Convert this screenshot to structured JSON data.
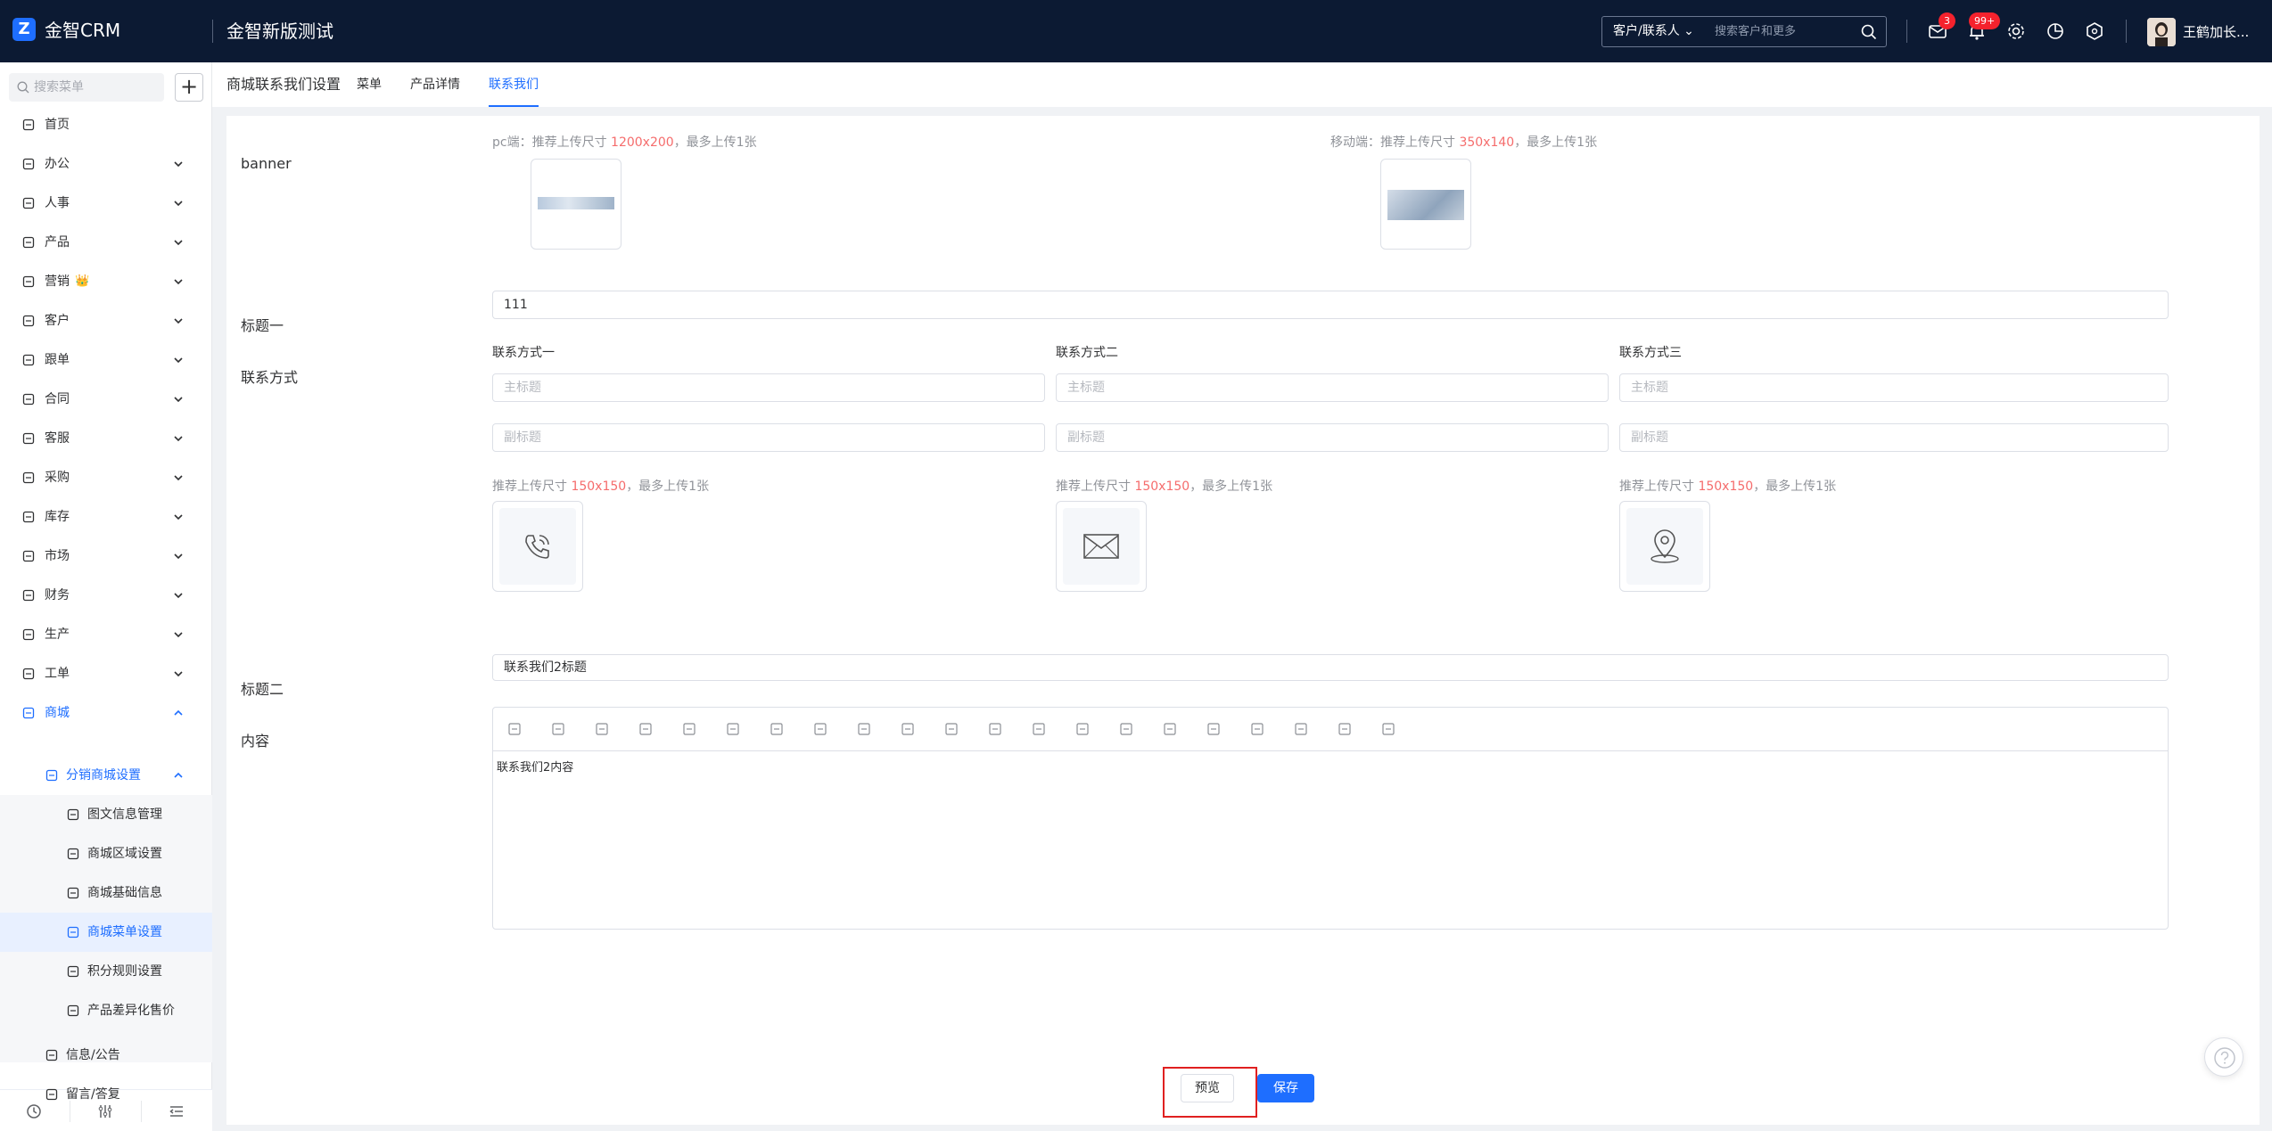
{
  "header": {
    "logo_mark": "Z",
    "app_name": "金智CRM",
    "system_title": "金智新版测试",
    "search_scope": "客户/联系人",
    "search_placeholder": "搜索客户和更多",
    "message_badge": "3",
    "notify_badge": "99+",
    "user_name": "王鹤加长..."
  },
  "sidebar": {
    "search_placeholder": "搜索菜单",
    "add_label": "+",
    "items": [
      {
        "label": "首页",
        "icon": "home-icon"
      },
      {
        "label": "办公",
        "icon": "office-icon"
      },
      {
        "label": "人事",
        "icon": "people-icon"
      },
      {
        "label": "产品",
        "icon": "product-icon"
      },
      {
        "label": "营销",
        "icon": "marketing-icon",
        "crown": "👑"
      },
      {
        "label": "客户",
        "icon": "customer-icon"
      },
      {
        "label": "跟单",
        "icon": "follow-icon"
      },
      {
        "label": "合同",
        "icon": "contract-icon"
      },
      {
        "label": "客服",
        "icon": "service-icon"
      },
      {
        "label": "采购",
        "icon": "purchase-icon"
      },
      {
        "label": "库存",
        "icon": "stock-icon"
      },
      {
        "label": "市场",
        "icon": "market-icon"
      },
      {
        "label": "财务",
        "icon": "finance-icon"
      },
      {
        "label": "生产",
        "icon": "production-icon"
      },
      {
        "label": "工单",
        "icon": "ticket-icon"
      },
      {
        "label": "商城",
        "icon": "mall-icon"
      }
    ],
    "sub_group": "分销商城设置",
    "sub_items": [
      {
        "label": "图文信息管理"
      },
      {
        "label": "商城区域设置"
      },
      {
        "label": "商城基础信息"
      },
      {
        "label": "商城菜单设置"
      },
      {
        "label": "积分规则设置"
      },
      {
        "label": "产品差异化售价"
      }
    ],
    "extra_items": [
      {
        "label": "信息/公告"
      },
      {
        "label": "留言/答复"
      }
    ]
  },
  "tabs": {
    "page_title": "商城联系我们设置",
    "items": [
      "菜单",
      "产品详情",
      "联系我们"
    ],
    "active": "联系我们"
  },
  "banner": {
    "label": "banner",
    "pc_prefix": "pc端：推荐上传尺寸 ",
    "pc_size": "1200x200",
    "pc_suffix": "，最多上传1张",
    "mobile_prefix": "移动端：推荐上传尺寸 ",
    "mobile_size": "350x140",
    "mobile_suffix": "，最多上传1张"
  },
  "title_one": {
    "label": "标题一",
    "value": "111"
  },
  "contact": {
    "label": "联系方式",
    "columns": [
      {
        "title": "联系方式一",
        "main_ph": "主标题",
        "sub_ph": "副标题",
        "icon": "phone-icon"
      },
      {
        "title": "联系方式二",
        "main_ph": "主标题",
        "sub_ph": "副标题",
        "icon": "mail-icon"
      },
      {
        "title": "联系方式三",
        "main_ph": "主标题",
        "sub_ph": "副标题",
        "icon": "location-icon"
      }
    ],
    "upload_prefix": "推荐上传尺寸 ",
    "upload_size": "150x150",
    "upload_suffix": "，最多上传1张"
  },
  "title_two": {
    "label": "标题二",
    "value": "联系我们2标题"
  },
  "content": {
    "label": "内容",
    "text": "联系我们2内容",
    "toolbar": [
      "source-icon",
      "undo-icon",
      "redo-icon",
      "strikethrough-icon",
      "heading-icon",
      "clear-format-icon",
      "font-color-icon",
      "bg-color-icon",
      "bold-icon",
      "italic-icon",
      "underline-icon",
      "align-left-icon",
      "align-center-icon",
      "align-right-icon",
      "justify-icon",
      "table-icon",
      "image-icon",
      "attachment-icon",
      "fullscreen-icon",
      "ordered-list-icon",
      "bullet-list-icon"
    ]
  },
  "actions": {
    "preview": "预览",
    "save": "保存"
  },
  "colors": {
    "brand": "#1e6eff",
    "header_bg": "#0c1a33",
    "hint_red": "#f56c6c",
    "highlight": "#e02020"
  }
}
